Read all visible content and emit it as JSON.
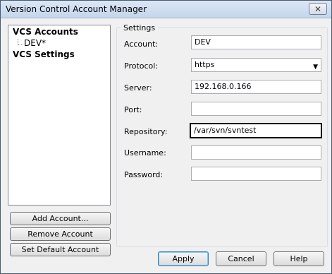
{
  "window": {
    "title": "Version Control Account Manager",
    "close_glyph": "✕"
  },
  "tree": {
    "nodes": [
      {
        "label": "VCS Accounts"
      },
      {
        "label": "DEV*"
      },
      {
        "label": "VCS Settings"
      }
    ]
  },
  "buttons": {
    "add_account": "Add Account...",
    "remove_account": "Remove Account",
    "set_default": "Set Default Account",
    "apply": "Apply",
    "cancel": "Cancel",
    "help": "Help"
  },
  "settings": {
    "group_label": "Settings",
    "account_label": "Account:",
    "account_value": "DEV",
    "protocol_label": "Protocol:",
    "protocol_value": "https",
    "server_label": "Server:",
    "server_value": "192.168.0.166",
    "port_label": "Port:",
    "port_value": "",
    "repository_label": "Repository:",
    "repository_value": "/var/svn/svntest",
    "username_label": "Username:",
    "username_value": "",
    "password_label": "Password:",
    "password_value": ""
  },
  "icons": {
    "dropdown": "chevron-down-icon",
    "close": "close-icon"
  }
}
